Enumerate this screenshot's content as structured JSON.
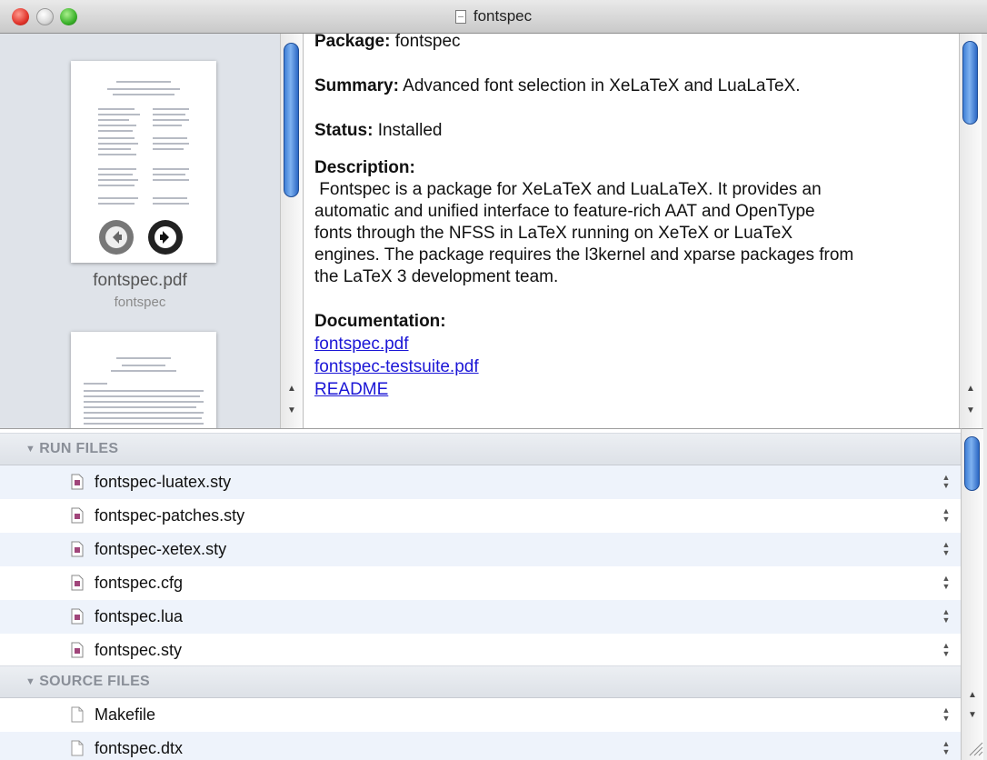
{
  "window": {
    "title": "fontspec"
  },
  "sidebar": {
    "thumbnails": [
      {
        "filename": "fontspec.pdf",
        "package": "fontspec"
      }
    ]
  },
  "details": {
    "package_label": "Package:",
    "package_value": "fontspec",
    "summary_label": "Summary:",
    "summary_value": "Advanced font selection in XeLaTeX and LuaLaTeX.",
    "status_label": "Status:",
    "status_value": "Installed",
    "description_label": "Description:",
    "description_lines": [
      " Fontspec is a package for XeLaTeX and LuaLaTeX. It provides an",
      "automatic and unified interface to feature-rich AAT and OpenType",
      "fonts through the NFSS in LaTeX running on XeTeX or LuaTeX",
      "engines. The package requires the l3kernel and xparse packages from",
      "the LaTeX 3 development team."
    ],
    "documentation_label": "Documentation:",
    "documentation_links": [
      "fontspec.pdf",
      "fontspec-testsuite.pdf",
      "README"
    ]
  },
  "files": {
    "run_header": "RUN FILES",
    "run_files": [
      "fontspec-luatex.sty",
      "fontspec-patches.sty",
      "fontspec-xetex.sty",
      "fontspec.cfg",
      "fontspec.lua",
      "fontspec.sty"
    ],
    "source_header": "SOURCE FILES",
    "source_files": [
      "Makefile",
      "fontspec.dtx"
    ]
  },
  "icons": {
    "close": "close-button-icon",
    "minimize": "minimize-button-icon",
    "zoom": "zoom-button-icon",
    "prev": "arrow-left-icon",
    "next": "arrow-right-icon",
    "run_file": "tex-file-icon",
    "source_file": "plain-file-icon"
  },
  "colors": {
    "link": "#1b16d6",
    "scroll_thumb": "#3f7fd6"
  }
}
